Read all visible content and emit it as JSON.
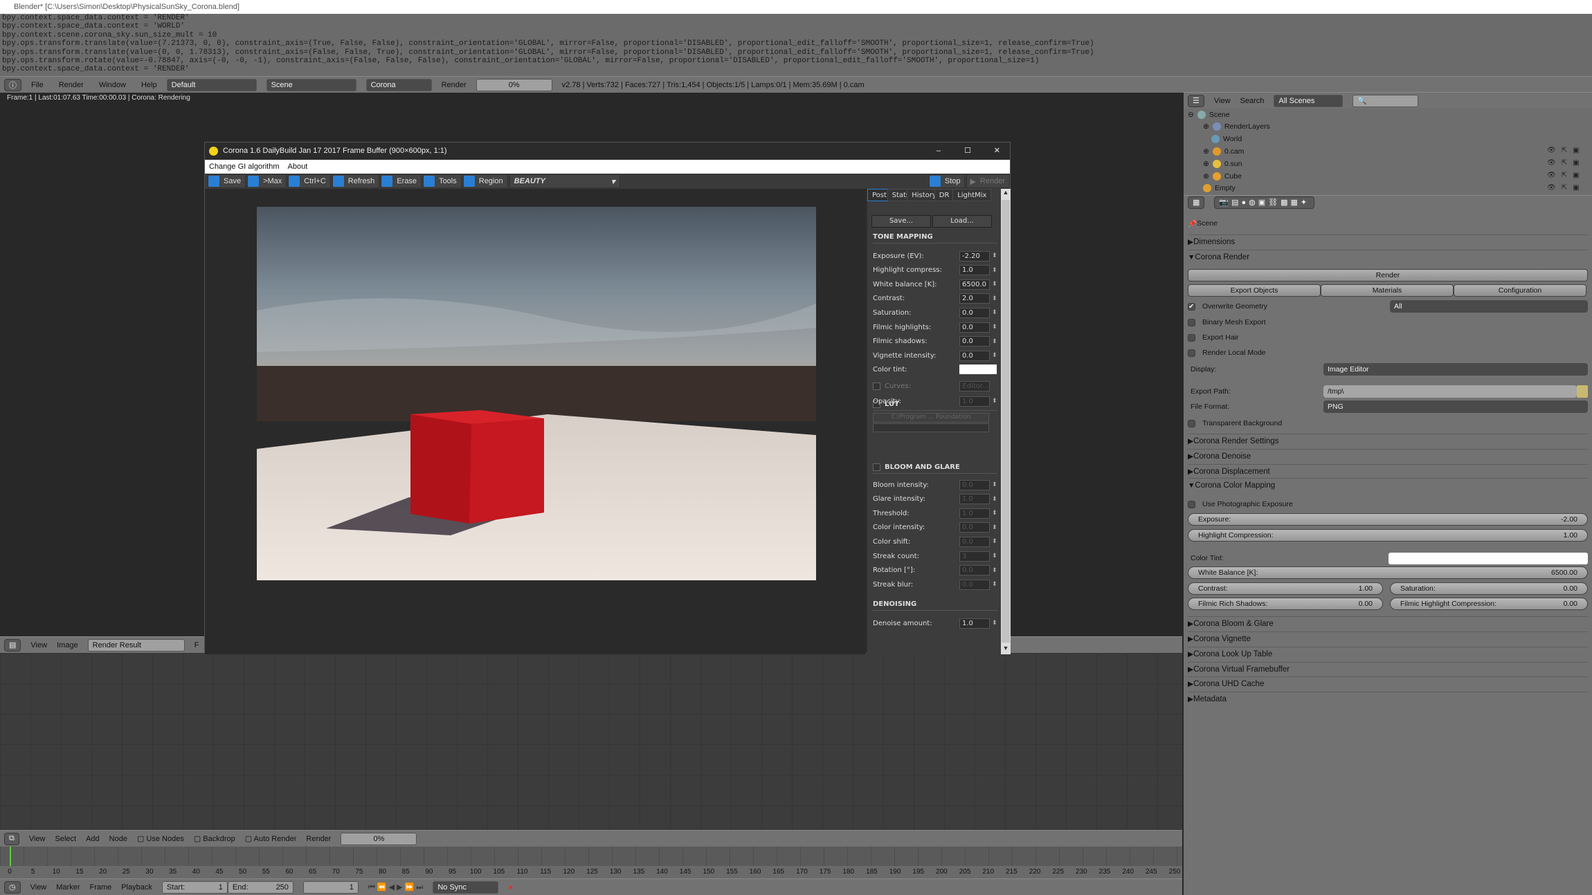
{
  "window_title": "Blender* [C:\\Users\\Simon\\Desktop\\PhysicalSunSky_Corona.blend]",
  "console_lines": [
    "bpy.context.space_data.context = 'RENDER'",
    "bpy.context.space_data.context = 'WORLD'",
    "bpy.context.scene.corona_sky.sun_size_mult = 10",
    "bpy.ops.transform.translate(value=(7.21373, 0, 0), constraint_axis=(True, False, False), constraint_orientation='GLOBAL', mirror=False, proportional='DISABLED', proportional_edit_falloff='SMOOTH', proportional_size=1, release_confirm=True)",
    "bpy.ops.transform.translate(value=(0, 0, 1.78313), constraint_axis=(False, False, True), constraint_orientation='GLOBAL', mirror=False, proportional='DISABLED', proportional_edit_falloff='SMOOTH', proportional_size=1, release_confirm=True)",
    "bpy.ops.transform.rotate(value=-0.78847, axis=(-0, -0, -1), constraint_axis=(False, False, False), constraint_orientation='GLOBAL', mirror=False, proportional='DISABLED', proportional_edit_falloff='SMOOTH', proportional_size=1)",
    "bpy.context.space_data.context = 'RENDER'"
  ],
  "info_header": {
    "menus": [
      "File",
      "Render",
      "Window",
      "Help"
    ],
    "layout": "Default",
    "scene": "Scene",
    "engine": "Corona",
    "render_label": "Render",
    "progress": "0%",
    "stats": "v2.78 | Verts:732 | Faces:727 | Tris:1,454 | Objects:1/5 | Lamps:0/1 | Mem:35.69M | 0.cam"
  },
  "status_text": "Frame:1 | Last:01:07.63 Time:00:00.03 | Corona: Rendering",
  "image_header": {
    "menus": [
      "View",
      "Image"
    ],
    "image": "Render Result",
    "f_label": "F"
  },
  "node_header": {
    "menus": [
      "View",
      "Select",
      "Add",
      "Node"
    ],
    "use_nodes": "Use Nodes",
    "backdrop": "Backdrop",
    "auto_render": "Auto Render",
    "render_label": "Render",
    "progress": "0%"
  },
  "timeline": {
    "ruler_start": 0,
    "ruler_end": 250,
    "ruler_step": 5,
    "current_frame_marker": 0
  },
  "timeline_header": {
    "menus": [
      "View",
      "Marker",
      "Frame",
      "Playback"
    ],
    "start_label": "Start:",
    "start": "1",
    "end_label": "End:",
    "end": "250",
    "current": "1",
    "sync": "No Sync"
  },
  "corona": {
    "title": "Corona 1.6 DailyBuild Jan 17 2017 Frame Buffer (900×600px, 1:1)",
    "menu": [
      "Change GI algorithm",
      "About"
    ],
    "toolbar": [
      "Save",
      ">Max",
      "Ctrl+C",
      "Refresh",
      "Erase",
      "Tools",
      "Region"
    ],
    "channel": "BEAUTY",
    "stop": "Stop",
    "render": "Render",
    "tabs": [
      "Post",
      "Stats",
      "History",
      "DR",
      "LightMix"
    ],
    "save": "Save...",
    "load": "Load...",
    "tone_mapping": "TONE MAPPING",
    "tone_rows": [
      [
        "Exposure (EV):",
        "-2.20"
      ],
      [
        "Highlight compress:",
        "1.0"
      ],
      [
        "White balance [K]:",
        "6500.0"
      ],
      [
        "Contrast:",
        "2.0"
      ],
      [
        "Saturation:",
        "0.0"
      ],
      [
        "Filmic highlights:",
        "0.0"
      ],
      [
        "Filmic shadows:",
        "0.0"
      ],
      [
        "Vignette intensity:",
        "0.0"
      ]
    ],
    "color_tint": "Color tint:",
    "curves": "Curves:",
    "editor": "Editor...",
    "lut": "LUT",
    "lut_path": "C:/Program ... Foundation",
    "opacity": "Opacity:",
    "opacity_value": "1.0",
    "bloom_glare": "BLOOM AND GLARE",
    "bloom_rows": [
      [
        "Bloom intensity:",
        "0.0"
      ],
      [
        "Glare intensity:",
        "1.0"
      ],
      [
        "Threshold:",
        "1.0"
      ],
      [
        "Color intensity:",
        "0.0"
      ],
      [
        "Color shift:",
        "0.0"
      ],
      [
        "Streak count:",
        "3"
      ],
      [
        "Rotation [°]:",
        "0.0"
      ],
      [
        "Streak blur:",
        "0.0"
      ]
    ],
    "denoising": "DENOISING",
    "denoise_amount": "Denoise amount:",
    "denoise_value": "1.0"
  },
  "outliner": {
    "view": "View",
    "search": "Search",
    "filter": "All Scenes",
    "items": [
      {
        "label": "Scene"
      },
      {
        "label": "RenderLayers"
      },
      {
        "label": "World"
      },
      {
        "label": "0.cam"
      },
      {
        "label": "0.sun"
      },
      {
        "label": "Cube"
      },
      {
        "label": "Empty"
      }
    ]
  },
  "properties": {
    "context": "Scene",
    "dimensions": "Dimensions",
    "corona_render": "Corona Render",
    "render_btn": "Render",
    "export_objects": "Export Objects",
    "materials": "Materials",
    "configuration": "Configuration",
    "overwrite": "Overwrite Geometry",
    "overwrite_mode": "All",
    "binary": "Binary Mesh Export",
    "hair": "Export Hair",
    "local": "Render Local Mode",
    "display_label": "Display:",
    "display": "Image Editor",
    "path_label": "Export Path:",
    "path": "/tmp\\",
    "format_label": "File Format:",
    "format": "PNG",
    "transparent": "Transparent Background",
    "render_settings": "Corona Render Settings",
    "denoise": "Corona Denoise",
    "displacement": "Corona Displacement",
    "color_mapping": "Corona Color Mapping",
    "use_photo": "Use Photographic Exposure",
    "exposure_label": "Exposure:",
    "exposure": "-2.00",
    "highlight_label": "Highlight Compression:",
    "highlight": "1.00",
    "tint_label": "Color Tint:",
    "wb_label": "White Balance [K]:",
    "wb": "6500.00",
    "contrast_label": "Contrast:",
    "contrast": "1.00",
    "saturation_label": "Saturation:",
    "saturation": "0.00",
    "filmic_shadows_label": "Filmic Rich Shadows:",
    "filmic_shadows": "0.00",
    "filmic_hl_label": "Filmic Highlight Compression:",
    "filmic_hl": "0.00",
    "collapsed": [
      "Corona Bloom & Glare",
      "Corona Vignette",
      "Corona Look Up Table",
      "Corona Virtual Framebuffer",
      "Corona UHD Cache",
      "Metadata"
    ],
    "checked": {
      "overwrite": true,
      "binary": false,
      "hair": false,
      "local": false,
      "transparent": false,
      "use_photo": false
    }
  },
  "colors": {
    "accent": "#2a7fd4",
    "cube": "#c8141a",
    "timeline_cursor": "#5fcf3a"
  }
}
